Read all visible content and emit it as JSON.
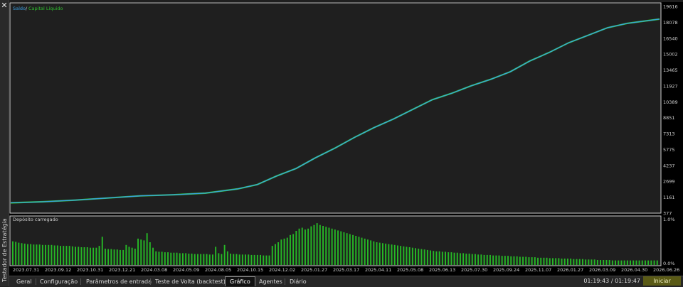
{
  "window": {
    "side_title": "Testador de Estratégia"
  },
  "colors": {
    "balance": "#3aa0e6",
    "equity": "#30c030",
    "deposit_bar": "#26b926",
    "background": "#1f1f1f",
    "grid": "#cfcfcf"
  },
  "icons": {
    "close": "close-icon"
  },
  "main_chart": {
    "legend_balance": "Saldo",
    "legend_separator": "/",
    "legend_equity": "Capital Líquido",
    "y_ticks": [
      "19616",
      "18078",
      "16540",
      "15002",
      "13465",
      "11927",
      "10389",
      "8851",
      "7313",
      "5775",
      "4237",
      "2699",
      "1161",
      "377"
    ]
  },
  "lower_chart": {
    "title": "Depósito carregado",
    "y_ticks": [
      "1.0%",
      "0.0%"
    ]
  },
  "x_ticks": [
    "2023.07.31",
    "2023.09.12",
    "2023.10.31",
    "2023.12.21",
    "2024.03.08",
    "2024.05.09",
    "2024.08.05",
    "2024.10.15",
    "2024.12.02",
    "2025.01.27",
    "2025.03.17",
    "2025.04.11",
    "2025.05.08",
    "2025.06.13",
    "2025.07.30",
    "2025.09.24",
    "2025.11.07",
    "2026.01.27",
    "2026.03.09",
    "2026.04.30",
    "2026.06.26"
  ],
  "chart_data": [
    {
      "type": "line",
      "title": "",
      "x": [
        0,
        0.05,
        0.1,
        0.15,
        0.2,
        0.25,
        0.3,
        0.35,
        0.38,
        0.41,
        0.44,
        0.47,
        0.5,
        0.53,
        0.56,
        0.59,
        0.62,
        0.65,
        0.68,
        0.71,
        0.74,
        0.77,
        0.8,
        0.83,
        0.86,
        0.89,
        0.92,
        0.95,
        1.0
      ],
      "series": [
        {
          "name": "Saldo",
          "values": [
            1400,
            1500,
            1650,
            1850,
            2050,
            2150,
            2300,
            2700,
            3100,
            3900,
            4600,
            5600,
            6500,
            7500,
            8400,
            9200,
            10100,
            11000,
            11600,
            12300,
            12900,
            13600,
            14600,
            15400,
            16300,
            17000,
            17700,
            18100,
            18500
          ]
        },
        {
          "name": "Capital Líquido",
          "values": [
            1400,
            1500,
            1650,
            1850,
            2050,
            2150,
            2300,
            2700,
            3100,
            3900,
            4600,
            5600,
            6500,
            7500,
            8400,
            9200,
            10100,
            11000,
            11600,
            12300,
            12900,
            13600,
            14600,
            15400,
            16300,
            17000,
            17700,
            18100,
            18500
          ]
        }
      ],
      "ylim": [
        377,
        19616
      ],
      "grid": false
    },
    {
      "type": "bar",
      "title": "Depósito carregado",
      "ylim": [
        0,
        1.0
      ],
      "values": [
        0.52,
        0.51,
        0.49,
        0.48,
        0.47,
        0.46,
        0.46,
        0.45,
        0.45,
        0.45,
        0.44,
        0.44,
        0.44,
        0.44,
        0.43,
        0.43,
        0.42,
        0.42,
        0.42,
        0.42,
        0.41,
        0.4,
        0.4,
        0.39,
        0.39,
        0.39,
        0.38,
        0.38,
        0.38,
        0.42,
        0.62,
        0.36,
        0.35,
        0.35,
        0.34,
        0.34,
        0.33,
        0.33,
        0.44,
        0.4,
        0.38,
        0.36,
        0.58,
        0.56,
        0.54,
        0.7,
        0.5,
        0.38,
        0.3,
        0.29,
        0.29,
        0.28,
        0.28,
        0.27,
        0.27,
        0.27,
        0.26,
        0.26,
        0.26,
        0.25,
        0.25,
        0.24,
        0.24,
        0.24,
        0.24,
        0.24,
        0.23,
        0.23,
        0.4,
        0.26,
        0.24,
        0.44,
        0.3,
        0.25,
        0.24,
        0.24,
        0.23,
        0.23,
        0.23,
        0.23,
        0.22,
        0.22,
        0.22,
        0.22,
        0.21,
        0.21,
        0.21,
        0.42,
        0.46,
        0.5,
        0.56,
        0.58,
        0.6,
        0.66,
        0.68,
        0.75,
        0.8,
        0.82,
        0.78,
        0.8,
        0.85,
        0.88,
        0.92,
        0.88,
        0.86,
        0.84,
        0.82,
        0.8,
        0.78,
        0.76,
        0.74,
        0.72,
        0.7,
        0.68,
        0.66,
        0.64,
        0.62,
        0.6,
        0.58,
        0.56,
        0.54,
        0.52,
        0.5,
        0.49,
        0.48,
        0.47,
        0.46,
        0.45,
        0.44,
        0.43,
        0.42,
        0.41,
        0.4,
        0.39,
        0.38,
        0.37,
        0.36,
        0.35,
        0.34,
        0.33,
        0.32,
        0.31,
        0.3,
        0.3,
        0.29,
        0.29,
        0.28,
        0.28,
        0.27,
        0.27,
        0.26,
        0.26,
        0.25,
        0.25,
        0.24,
        0.24,
        0.23,
        0.23,
        0.22,
        0.22,
        0.22,
        0.21,
        0.21,
        0.21,
        0.2,
        0.2,
        0.2,
        0.19,
        0.19,
        0.19,
        0.18,
        0.18,
        0.18,
        0.17,
        0.17,
        0.17,
        0.16,
        0.16,
        0.16,
        0.16,
        0.15,
        0.15,
        0.15,
        0.15,
        0.14,
        0.14,
        0.14,
        0.14,
        0.13,
        0.13,
        0.13,
        0.13,
        0.12,
        0.12,
        0.12,
        0.12,
        0.11,
        0.11,
        0.11,
        0.11,
        0.11,
        0.1,
        0.1,
        0.1,
        0.1,
        0.1,
        0.1,
        0.1,
        0.1,
        0.1,
        0.1,
        0.1,
        0.1,
        0.1,
        0.1,
        0.1,
        0.1
      ]
    }
  ],
  "tabs": [
    "Geral",
    "Configuração",
    "Parâmetros de entrada",
    "Teste de Volta (backtest)",
    "Gráfico",
    "Agentes",
    "Diário"
  ],
  "status": {
    "elapsed_time": "01:19:43",
    "separator": "/",
    "total_time": "01:19:47"
  },
  "start_button": "Iniciar"
}
